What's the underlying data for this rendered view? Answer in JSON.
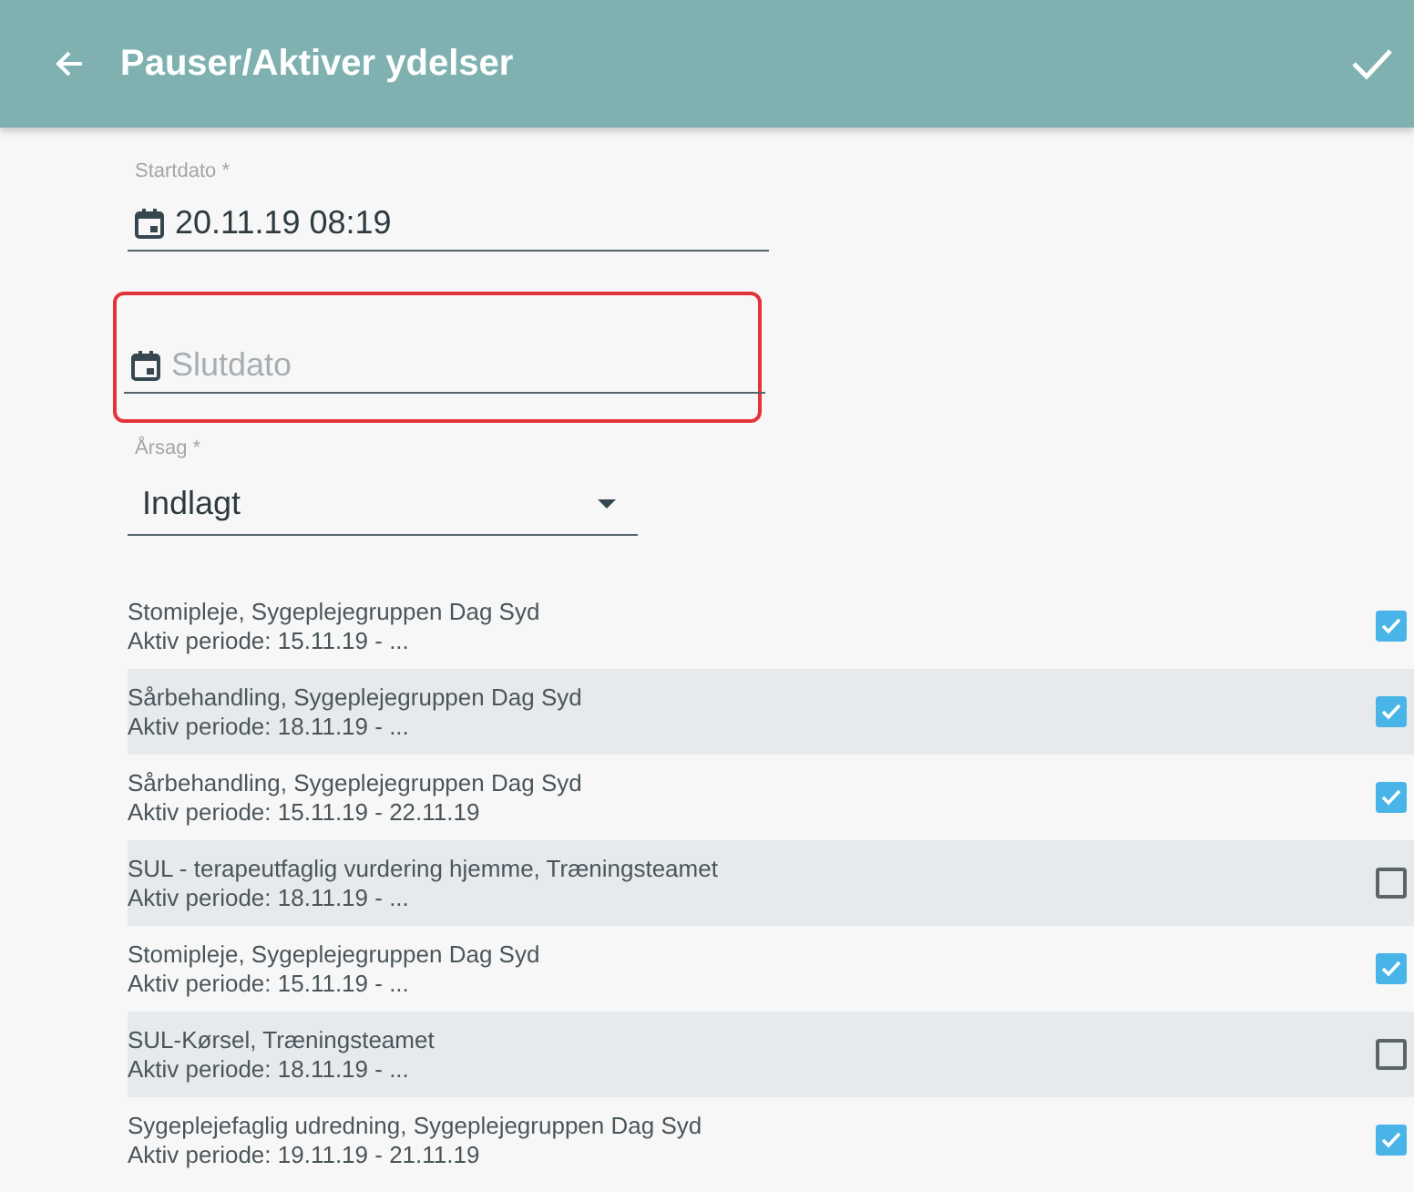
{
  "header": {
    "title": "Pauser/Aktiver ydelser"
  },
  "start_field": {
    "label": "Startdato *",
    "value": "20.11.19 08:19"
  },
  "end_field": {
    "placeholder": "Slutdato",
    "highlighted": true
  },
  "reason_field": {
    "label": "Årsag *",
    "value": "Indlagt"
  },
  "services": [
    {
      "name": "Stomipleje, Sygeplejegruppen Dag Syd",
      "period": "Aktiv periode: 15.11.19 - ...",
      "checked": true
    },
    {
      "name": "Sårbehandling, Sygeplejegruppen Dag Syd",
      "period": "Aktiv periode: 18.11.19 - ...",
      "checked": true
    },
    {
      "name": "Sårbehandling, Sygeplejegruppen Dag Syd",
      "period": "Aktiv periode: 15.11.19 - 22.11.19",
      "checked": true
    },
    {
      "name": "SUL - terapeutfaglig vurdering hjemme, Træningsteamet",
      "period": "Aktiv periode: 18.11.19 - ...",
      "checked": false
    },
    {
      "name": "Stomipleje, Sygeplejegruppen Dag Syd",
      "period": "Aktiv periode: 15.11.19 - ...",
      "checked": true
    },
    {
      "name": "SUL-Kørsel, Træningsteamet",
      "period": "Aktiv periode: 18.11.19 - ...",
      "checked": false
    },
    {
      "name": "Sygeplejefaglig udredning, Sygeplejegruppen Dag Syd",
      "period": "Aktiv periode: 19.11.19 - 21.11.19",
      "checked": true
    }
  ]
}
